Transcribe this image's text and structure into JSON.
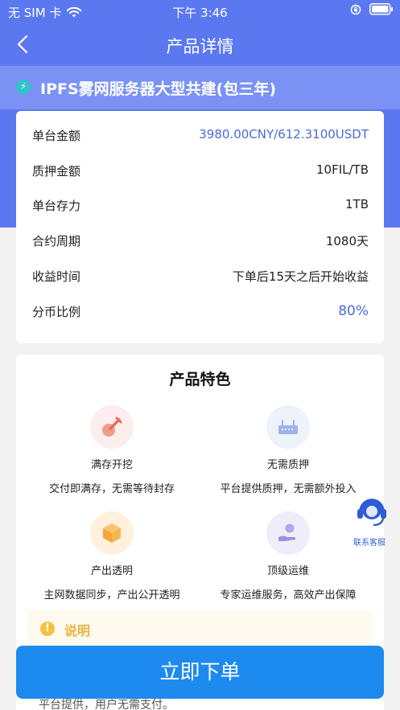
{
  "status_bar": {
    "carrier": "无 SIM 卡",
    "time": "下午 3:46"
  },
  "nav": {
    "title": "产品详情"
  },
  "product": {
    "title": "IPFS雾网服务器大型共建(包三年)",
    "icon": "lightning-icon"
  },
  "info_rows": [
    {
      "label": "单台金额",
      "value": "3980.00CNY/612.3100USDT"
    },
    {
      "label": "质押金额",
      "value": "10FIL/TB"
    },
    {
      "label": "单台存力",
      "value": "1TB"
    },
    {
      "label": "合约周期",
      "value": "1080天"
    },
    {
      "label": "收益时间",
      "value": "下单后15天之后开始收益"
    },
    {
      "label": "分币比例",
      "value": "80%"
    }
  ],
  "features": {
    "title": "产品特色",
    "items": [
      {
        "name": "满存开挖",
        "desc": "交付即满存，无需等待封存",
        "icon": "shovel-icon"
      },
      {
        "name": "无需质押",
        "desc": "平台提供质押，无需额外投入",
        "icon": "router-icon"
      },
      {
        "name": "产出透明",
        "desc": "主网数据同步，产出公开透明",
        "icon": "box-icon"
      },
      {
        "name": "顶级运维",
        "desc": "专家运维服务，高效产出保障",
        "icon": "hand-coin-icon"
      }
    ]
  },
  "notice": {
    "title": "说明",
    "text": "平台提供，用户无需支付。"
  },
  "customer_service": {
    "label": "联系客服"
  },
  "buy_button": {
    "label": "立即下单"
  },
  "colors": {
    "primary": "#5b78f0",
    "accent_text": "#4a6ad8",
    "button": "#1d8af0",
    "notice": "#e9b23c"
  }
}
